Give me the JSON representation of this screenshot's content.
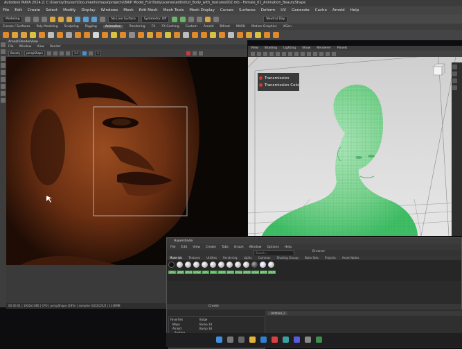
{
  "app": {
    "title": "Autodesk MAYA 2024.2: C:\\Users\\y3nyson\\Documents\\maya\\projects\\BRIP Model_Full Body\\scenes\\edits\\full_Body_with_textures002.mb - Female_01_Animation_BeautyShape"
  },
  "menubar": [
    "File",
    "Edit",
    "Create",
    "Select",
    "Modify",
    "Display",
    "Windows",
    "Mesh",
    "Edit Mesh",
    "Mesh Tools",
    "Mesh Display",
    "Curves",
    "Surfaces",
    "Deform",
    "UV",
    "Generate",
    "Cache",
    "Arnold",
    "Help"
  ],
  "status_line": {
    "mode": "Modeling",
    "no_live_surface": "No Live Surface",
    "symmetry": "Symmetry: Off",
    "camera": "Neutral Day"
  },
  "shelf_tabs": [
    "Curves / Surfaces",
    "Poly Modeling",
    "Sculpting",
    "Rigging",
    "Animation",
    "Rendering",
    "FX",
    "FX Caching",
    "Custom",
    "Arnold",
    "Bifrost",
    "MASH",
    "Motion Graphics",
    "XGen"
  ],
  "shelf_active": "Animation",
  "render_view": {
    "title": "Arnold RenderView",
    "menu": [
      "File",
      "Window",
      "View",
      "Render"
    ],
    "display": "Beauty",
    "camera": "perspShape",
    "zoom": "1:1",
    "frame": "1",
    "status": "00:00:01 | 1920x1080 | CPU | perspShape (28%) | samples 4/2/2/2/2/2 | 1136MB"
  },
  "viewport": {
    "menu": [
      "View",
      "Shading",
      "Lighting",
      "Show",
      "Renderer",
      "Panels"
    ]
  },
  "hypershade": {
    "title": "Hypershade",
    "menu": [
      "File",
      "Edit",
      "View",
      "Create",
      "Tabs",
      "Graph",
      "Window",
      "Options",
      "Help"
    ],
    "browser_label": "Browser",
    "search_placeholder": "Search...",
    "tabs": [
      "Materials",
      "Textures",
      "Utilities",
      "Rendering",
      "Lights",
      "Cameras",
      "Shading Groups",
      "Bake Sets",
      "Projects",
      "Asset Nodes"
    ],
    "swatch_labels": [
      "aiSky",
      "aiStd",
      "aiStd1",
      "lambert",
      "aiSS",
      "blinn",
      "aiStd2",
      "aiStd3",
      "phong",
      "aiStd4",
      "lambert1",
      "aiStd5",
      "aiStd6"
    ],
    "create_label": "Create",
    "create_tree": [
      "Favorites",
      "Maya",
      "Arnold",
      "Surface"
    ],
    "create_list": [
      "Bulge",
      "Bump 2d",
      "Bump 3d"
    ],
    "graph_tab": "Untitled_1"
  },
  "attributes": {
    "transmission": "Transmission",
    "transmission_color": "Transmission Color"
  }
}
